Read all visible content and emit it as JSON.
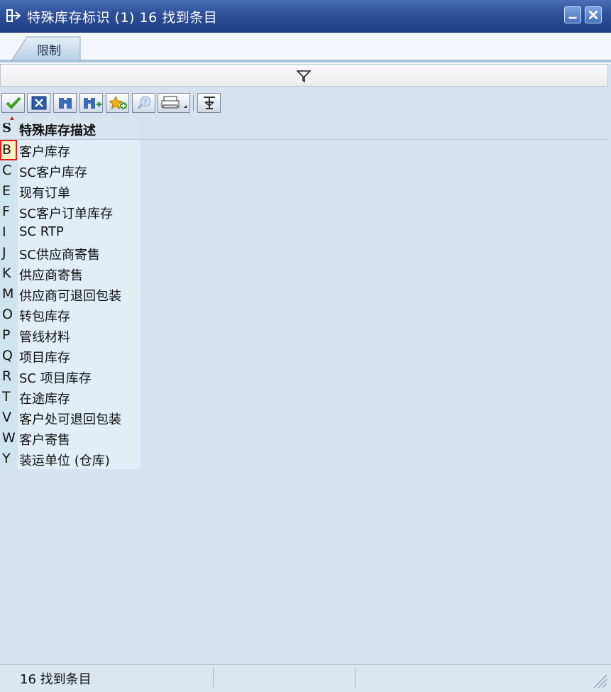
{
  "window": {
    "title": "特殊库存标识 (1)   16 找到条目"
  },
  "tabs": [
    {
      "label": "限制"
    }
  ],
  "toolbar": {
    "buttons": [
      "check-icon",
      "cancel-icon",
      "find-icon",
      "find-next-icon",
      "add-favorite-icon",
      "help-icon",
      "print-icon",
      "filter-icon"
    ]
  },
  "table": {
    "col_s": "S",
    "col_desc": "特殊库存描述",
    "rows": [
      {
        "key": "B",
        "desc": "客户库存"
      },
      {
        "key": "C",
        "desc": "SC客户库存"
      },
      {
        "key": "E",
        "desc": "现有订单"
      },
      {
        "key": "F",
        "desc": "SC客户订单库存"
      },
      {
        "key": "I",
        "desc": "SC RTP"
      },
      {
        "key": "J",
        "desc": "SC供应商寄售"
      },
      {
        "key": "K",
        "desc": "供应商寄售"
      },
      {
        "key": "M",
        "desc": "供应商可退回包装"
      },
      {
        "key": "O",
        "desc": "转包库存"
      },
      {
        "key": "P",
        "desc": "管线材料"
      },
      {
        "key": "Q",
        "desc": "项目库存"
      },
      {
        "key": "R",
        "desc": "SC 项目库存"
      },
      {
        "key": "T",
        "desc": "在途库存"
      },
      {
        "key": "V",
        "desc": "客户处可退回包装"
      },
      {
        "key": "W",
        "desc": "客户寄售"
      },
      {
        "key": "Y",
        "desc": "装运单位 (仓库)"
      }
    ]
  },
  "status": {
    "text": "16 找到条目"
  },
  "colors": {
    "titlebar": "#2d4f98",
    "background": "#d4e3ef",
    "selected_outline": "#e02020"
  }
}
